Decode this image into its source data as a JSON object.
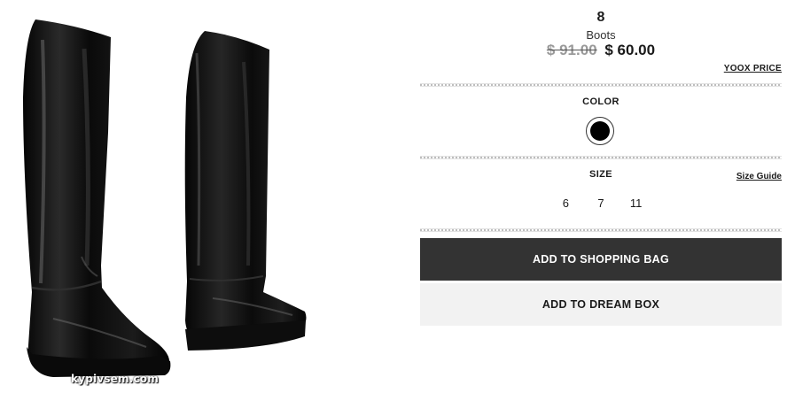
{
  "product": {
    "brand": "8",
    "category": "Boots",
    "price_original": "$ 91.00",
    "price_current": "$ 60.00",
    "price_note_link": "YOOX PRICE"
  },
  "color": {
    "label": "COLOR",
    "selected_swatch": "#000000"
  },
  "size": {
    "label": "SIZE",
    "guide_link": "Size Guide",
    "options": [
      "6",
      "7",
      "11"
    ]
  },
  "actions": {
    "add_to_bag": "ADD TO SHOPPING BAG",
    "add_to_dream_box": "ADD TO DREAM BOX"
  },
  "watermark": "kypivsem.com",
  "colors": {
    "primary_button": "#333333",
    "secondary_button": "#f2f2f2"
  }
}
